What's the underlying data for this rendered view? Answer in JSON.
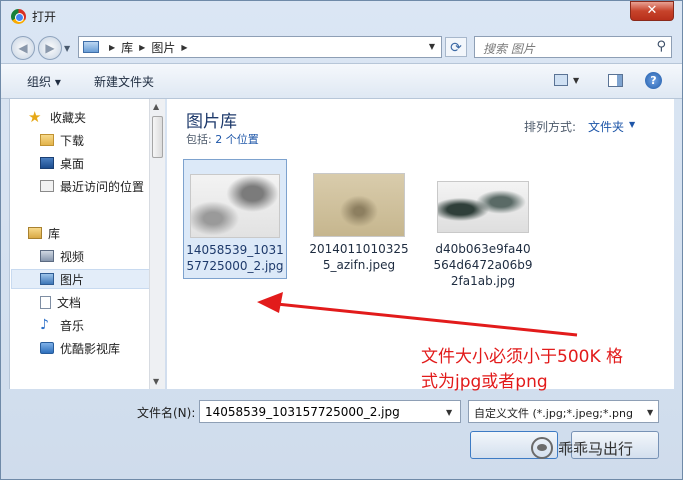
{
  "window": {
    "title": "打开",
    "close_label": "✕"
  },
  "navbar": {
    "back_glyph": "◀",
    "fwd_glyph": "▶",
    "breadcrumb": [
      "库",
      "图片"
    ],
    "search_placeholder": "搜索 图片"
  },
  "toolbar": {
    "organize_label": "组织 ▾",
    "new_folder_label": "新建文件夹",
    "help_label": "?"
  },
  "sidebar": {
    "items": [
      {
        "label": "收藏夹"
      },
      {
        "label": "下载"
      },
      {
        "label": "桌面"
      },
      {
        "label": "最近访问的位置"
      },
      {
        "label": "库"
      },
      {
        "label": "视频"
      },
      {
        "label": "图片"
      },
      {
        "label": "文档"
      },
      {
        "label": "音乐"
      },
      {
        "label": "优酷影视库"
      }
    ]
  },
  "content": {
    "title": "图片库",
    "subtitle_prefix": "包括: ",
    "subtitle_link": "2 个位置",
    "arrange_label": "排列方式:",
    "arrange_value": "文件夹",
    "files": [
      {
        "line1": "14058539_1031",
        "line2": "57725000_2.jpg",
        "line3": ""
      },
      {
        "line1": "2014011010325",
        "line2": "5_azifn.jpeg",
        "line3": ""
      },
      {
        "line1": "d40b063e9fa40",
        "line2": "564d6472a06b9",
        "line3": "2fa1ab.jpg"
      }
    ]
  },
  "bottom": {
    "filename_label": "文件名(N):",
    "filename_value": "14058539_103157725000_2.jpg",
    "filter_value": "自定义文件 (*.jpg;*.jpeg;*.png",
    "open_label": "",
    "cancel_label": ""
  },
  "annotation": {
    "line1": "文件大小必须小于500K 格",
    "line2": "式为jpg或者png"
  },
  "watermark": {
    "text": "乖乖马出行"
  },
  "colors": {
    "annotation": "#e21b1b",
    "link": "#1e56a8",
    "selection": "#dce9f8"
  }
}
